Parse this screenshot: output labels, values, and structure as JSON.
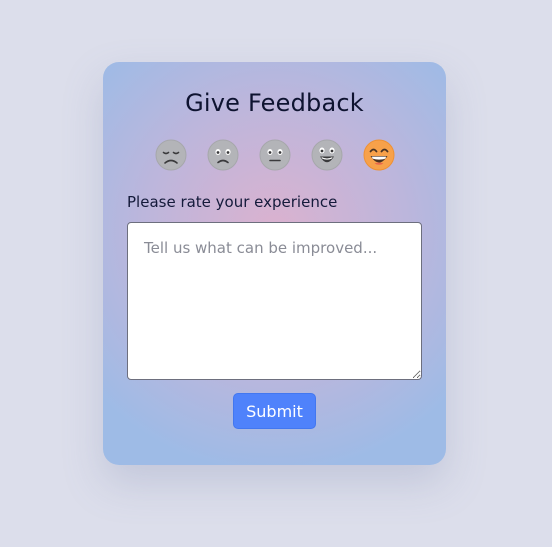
{
  "card": {
    "title": "Give Feedback",
    "rating_label": "Please rate your experience",
    "feedback_placeholder": "Tell us what can be improved...",
    "feedback_value": "",
    "submit_label": "Submit"
  },
  "emojis": [
    {
      "name": "very-dissatisfied",
      "selected": false
    },
    {
      "name": "dissatisfied",
      "selected": false
    },
    {
      "name": "neutral",
      "selected": false
    },
    {
      "name": "satisfied",
      "selected": false
    },
    {
      "name": "very-satisfied",
      "selected": true
    }
  ],
  "colors": {
    "page_background": "#dcdeeb",
    "gradient_center": "#dbb2cf",
    "gradient_edge": "#9ebbe6",
    "inactive_emoji": "#b3b4b8",
    "active_emoji": "#f7a14a",
    "submit_background": "#4f82fb",
    "title_text": "#0e1330"
  }
}
